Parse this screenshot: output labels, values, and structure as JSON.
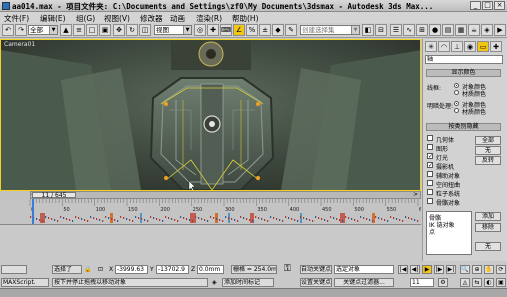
{
  "window": {
    "title": "aa014.max  - 项目文件夹: C:\\Documents and Settings\\zf0\\My Documents\\3dsmax  - Autodesk 3ds Max...",
    "controls": [
      "_",
      "□",
      "×"
    ]
  },
  "menu": {
    "items": [
      "文件(F)",
      "编辑(E)",
      "组(G)",
      "视图(V)",
      "修改器",
      "动画",
      "渲染(R)",
      "帮助(H)"
    ]
  },
  "toolbar": {
    "selection_filter": "全部",
    "reference_coord": "视图",
    "named_selection_placeholder": "创建选择集"
  },
  "viewport": {
    "label": "Camera01"
  },
  "command_panel": {
    "object_name": "轴",
    "display_color_rollout": "显示颜色",
    "wireframe_label": "线框:",
    "wireframe_options": [
      "对象颜色",
      "材质颜色"
    ],
    "shaded_label": "明暗处理:",
    "shaded_options": [
      "对象颜色",
      "材质颜色"
    ],
    "hide_by_category_rollout": "按类别隐藏",
    "categories": [
      {
        "label": "几何体",
        "checked": false
      },
      {
        "label": "图形",
        "checked": false
      },
      {
        "label": "灯光",
        "checked": true
      },
      {
        "label": "摄影机",
        "checked": true
      },
      {
        "label": "辅助对象",
        "checked": false
      },
      {
        "label": "空间扭曲",
        "checked": false
      },
      {
        "label": "粒子系统",
        "checked": false
      },
      {
        "label": "骨骼对象",
        "checked": false
      }
    ],
    "all_button": "全部",
    "none_button": "无",
    "invert_button": "反转",
    "list_text": [
      "骨骼",
      "IK 链对象",
      "点"
    ],
    "add_button": "添加",
    "remove_button": "移除",
    "none_button2": "无"
  },
  "timeline": {
    "frame_readout": "11 / 645",
    "ticks": [
      "0",
      "50",
      "100",
      "150",
      "200",
      "250",
      "300",
      "350",
      "400",
      "450",
      "500",
      "550",
      "600"
    ]
  },
  "status": {
    "selection": "选择了",
    "x_label": "X",
    "x_value": "-3999.63",
    "y_label": "Y",
    "y_value": "-13702.9",
    "z_label": "Z",
    "z_value": "0.0mm",
    "grid": "栅格 = 254.0mm",
    "auto_key": "自动关键点",
    "selected_object": "选定对象",
    "set_key": "设置关键点",
    "key_filters": "关键点过滤器...",
    "prompt": "按下并停止拖拽以移动对象",
    "add_time_tag": "添加时间标记",
    "frame_number": "11",
    "maxscript": "MAXScript."
  },
  "colors": {
    "viewport_border": "#f3d11c",
    "active_tool": "#f2c511",
    "selection_highlight": "#d7a416"
  }
}
